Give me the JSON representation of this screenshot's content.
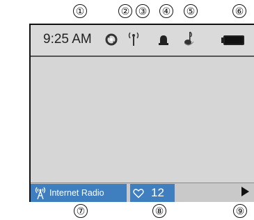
{
  "callouts": {
    "top": [
      "①",
      "②",
      "③",
      "④",
      "⑤",
      "⑥"
    ],
    "bottom": [
      "⑦",
      "⑧",
      "⑨"
    ]
  },
  "status_bar": {
    "time": "9:25 AM",
    "icons": [
      "sync-icon",
      "antenna-icon",
      "bell-icon",
      "music-note-icon",
      "battery-icon"
    ]
  },
  "bottom_bar": {
    "source_label": "Internet Radio",
    "source_icon": "radio-tower-icon",
    "likes_icon": "heart-icon",
    "likes_count": "12",
    "play_icon": "play-icon"
  },
  "colors": {
    "accent": "#3f7fc0",
    "screen_bg": "#d6d6d6"
  }
}
